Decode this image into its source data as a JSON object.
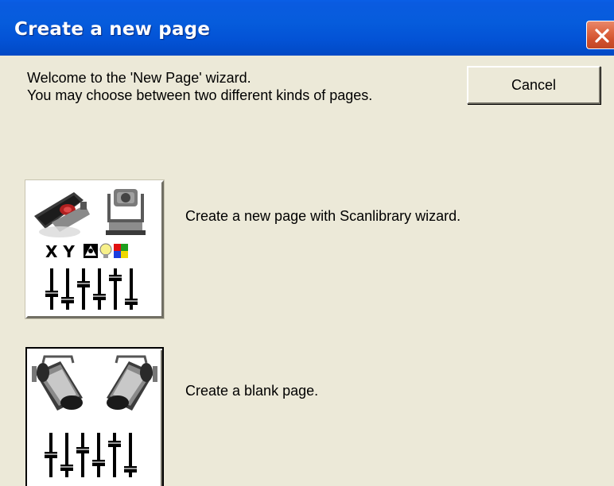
{
  "window": {
    "title": "Create a new page"
  },
  "intro": {
    "line1": "Welcome to the 'New Page' wizard.",
    "line2": "You may choose between two different kinds of pages."
  },
  "buttons": {
    "cancel_label": "Cancel"
  },
  "options": [
    {
      "label": "Create a new page with Scanlibrary wizard.",
      "icon": "scanner-moving-head-faders-icon",
      "icon_text": "X Y"
    },
    {
      "label": "Create a blank page.",
      "icon": "spotlights-faders-icon"
    }
  ],
  "colors": {
    "titlebar": "#0353d6",
    "background": "#ece9d8",
    "close_button": "#d0502c"
  }
}
